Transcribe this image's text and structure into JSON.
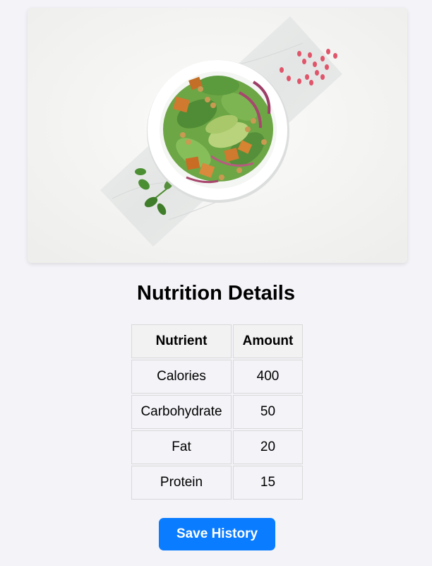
{
  "image": {
    "subject": "salad-bowl-photo",
    "colors": {
      "background": "#f6f6f5",
      "marble": "#e9ebea",
      "bowl": "#ffffff",
      "greens": "#5e9a3c",
      "tofu": "#d07a30",
      "onion": "#a8466e",
      "pomegranate": "#e0556a"
    }
  },
  "page": {
    "title": "Nutrition Details"
  },
  "table": {
    "headers": [
      "Nutrient",
      "Amount"
    ],
    "rows": [
      {
        "nutrient": "Calories",
        "amount": "400"
      },
      {
        "nutrient": "Carbohydrate",
        "amount": "50"
      },
      {
        "nutrient": "Fat",
        "amount": "20"
      },
      {
        "nutrient": "Protein",
        "amount": "15"
      }
    ]
  },
  "actions": {
    "save_label": "Save History",
    "accent": "#0a7cff"
  }
}
